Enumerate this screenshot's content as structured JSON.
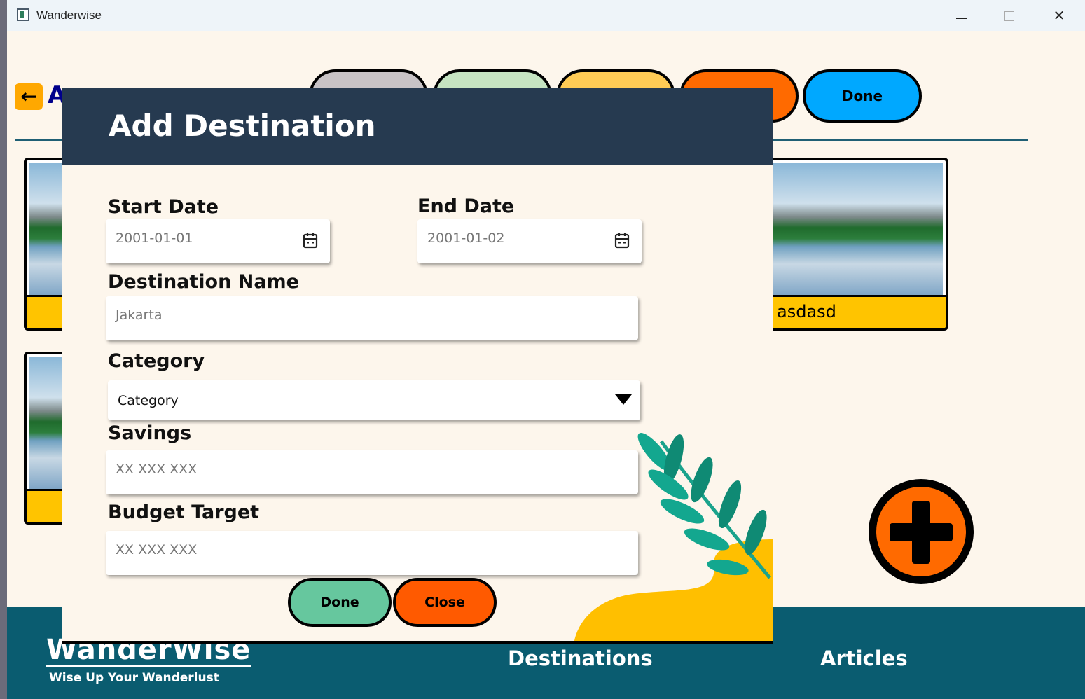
{
  "window": {
    "title": "Wanderwise"
  },
  "page": {
    "title_partial": "A"
  },
  "status_tabs": [
    {
      "label": "",
      "color": "#c8c3c6"
    },
    {
      "label": "",
      "color": "#c5e3c1"
    },
    {
      "label": "",
      "color": "#ffcb55"
    },
    {
      "label": "",
      "color": "#ff6a00"
    },
    {
      "label": "Done",
      "color": "#00a8ff"
    }
  ],
  "cards": [
    {
      "label": "asdasd"
    },
    {
      "label": ""
    },
    {
      "label": ""
    }
  ],
  "modal": {
    "title": "Add Destination",
    "start_date": {
      "label": "Start Date",
      "value": "2001-01-01"
    },
    "end_date": {
      "label": "End Date",
      "value": "2001-01-02"
    },
    "destination_name": {
      "label": "Destination Name",
      "value": "Jakarta"
    },
    "category": {
      "label": "Category",
      "value": "Category"
    },
    "savings": {
      "label": "Savings",
      "value": "XX XXX XXX"
    },
    "budget_target": {
      "label": "Budget Target",
      "value": "XX XXX XXX"
    },
    "done_label": "Done",
    "close_label": "Close"
  },
  "footer": {
    "brand": "WanderWise",
    "tagline": "Wise Up Your Wanderlust",
    "nav": [
      "Destinations",
      "Articles"
    ]
  },
  "colors": {
    "header": "#263a50",
    "footer": "#0a5c70",
    "done_button": "#66c79e",
    "close_button": "#ff5a00",
    "accent_orange": "#ff6a00",
    "card_label": "#ffc400"
  },
  "icons": [
    "app-icon",
    "arrow-left-icon",
    "calendar-icon",
    "chevron-down-icon",
    "plus-icon",
    "leaf-decoration"
  ]
}
